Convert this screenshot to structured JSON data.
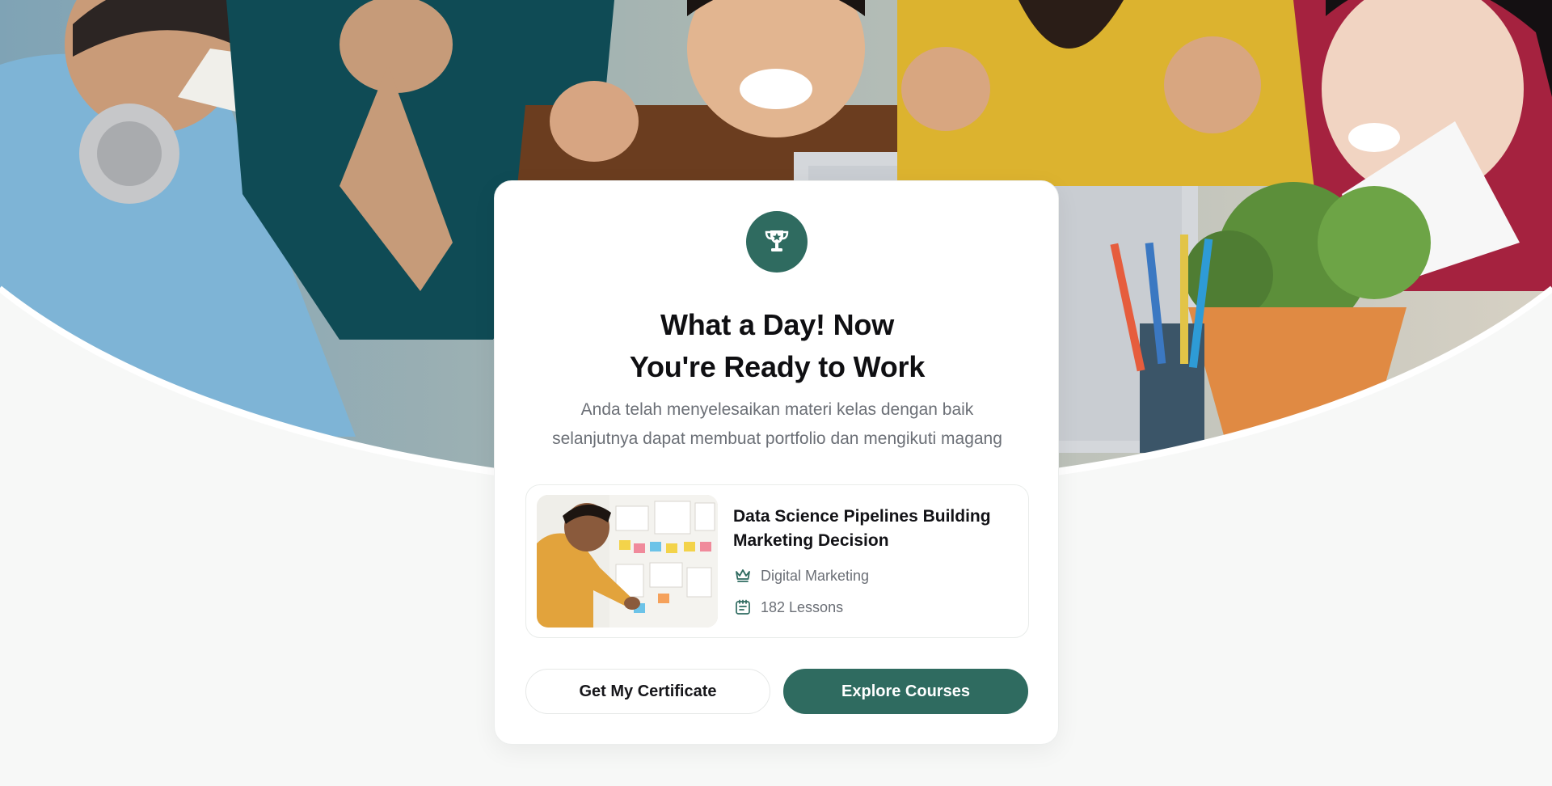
{
  "hero": {
    "image_alt": "group of colleagues celebrating"
  },
  "card": {
    "badge_icon": "trophy-icon",
    "title_line1": "What a Day! Now",
    "title_line2": "You're Ready to Work",
    "subtitle_line1": "Anda telah menyelesaikan materi kelas dengan baik",
    "subtitle_line2": "selanjutnya dapat membuat portfolio dan mengikuti magang"
  },
  "course": {
    "title_line1": "Data Science Pipelines Building",
    "title_line2": "Marketing Decision",
    "category_icon": "crown-icon",
    "category": "Digital Marketing",
    "lessons_icon": "notebook-icon",
    "lessons": "182 Lessons",
    "thumbnail_alt": "man placing sticky note on whiteboard"
  },
  "actions": {
    "certificate_label": "Get My Certificate",
    "explore_label": "Explore Courses"
  },
  "colors": {
    "accent": "#2f6b60",
    "page_bg": "#f7f8f7",
    "card_bg": "#ffffff",
    "muted_text": "#6b6f76"
  }
}
